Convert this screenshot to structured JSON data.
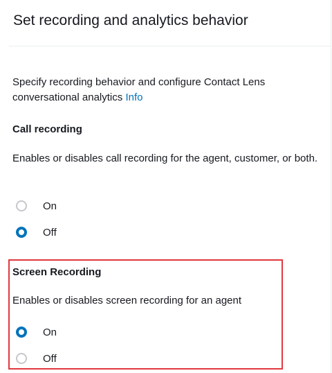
{
  "header": {
    "title": "Set recording and analytics behavior"
  },
  "description": {
    "text": "Specify recording behavior and configure Contact Lens conversational analytics",
    "info_link": "Info"
  },
  "call_recording": {
    "title": "Call recording",
    "description": "Enables or disables call recording for the agent, customer, or both.",
    "options": [
      {
        "label": "On",
        "selected": false
      },
      {
        "label": "Off",
        "selected": true
      }
    ]
  },
  "screen_recording": {
    "title": "Screen Recording",
    "description": "Enables or disables screen recording for an agent",
    "options": [
      {
        "label": "On",
        "selected": true
      },
      {
        "label": "Off",
        "selected": false
      }
    ]
  },
  "colors": {
    "accent": "#0073bb",
    "highlight": "#e0383e",
    "text": "#16191f",
    "radio_border": "#c6c6cd"
  }
}
